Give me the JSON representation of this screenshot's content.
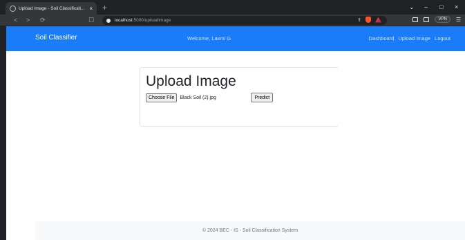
{
  "browser": {
    "tab_title": "Upload Image - Soil Classificati...",
    "tab_close": "×",
    "new_tab": "+",
    "url_host": "localhost",
    "url_path": ":5000/uploadImage",
    "vpn_label": "VPN",
    "window_controls": {
      "chevron": "⌄",
      "minimize": "–",
      "maximize": "□",
      "close": "×"
    },
    "nav": {
      "back": "<",
      "forward": ">",
      "reload": "⟳",
      "bookmark": "☐"
    }
  },
  "navbar": {
    "brand": "Soil Classifier",
    "welcome": "Welcome, Laxmi G",
    "links": [
      "Dashboard",
      "Upload Image",
      "Logout"
    ],
    "color": "#1a7cf7"
  },
  "upload_card": {
    "title": "Upload Image",
    "choose_file_label": "Choose File",
    "file_name": "Black Soil  (2).jpg",
    "predict_label": "Predict"
  },
  "footer": {
    "text": "© 2024 BEC - IS - Soil Classification System"
  }
}
